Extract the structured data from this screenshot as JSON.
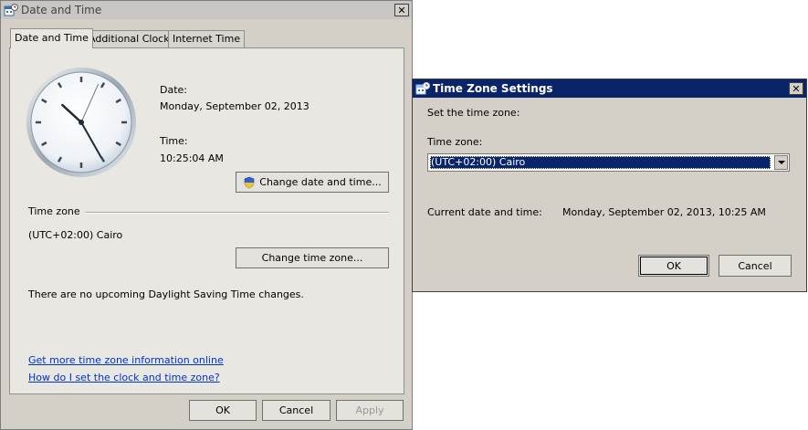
{
  "dt_window": {
    "title": "Date and Time",
    "close_label": "✕",
    "tabs": [
      "Date and Time",
      "Additional Clocks",
      "Internet Time"
    ],
    "date_label": "Date:",
    "date_value": "Monday, September 02, 2013",
    "time_label": "Time:",
    "time_value": "10:25:04 AM",
    "change_datetime_label": "Change date and time...",
    "timezone_heading": "Time zone",
    "timezone_value": "(UTC+02:00) Cairo",
    "change_timezone_label": "Change time zone...",
    "dst_text": "There are no upcoming Daylight Saving Time changes.",
    "link_more_info": "Get more time zone information online",
    "link_how_set": "How do I set the clock and time zone?",
    "ok_label": "OK",
    "cancel_label": "Cancel",
    "apply_label": "Apply"
  },
  "tz_window": {
    "title": "Time Zone Settings",
    "close_label": "✕",
    "instruction": "Set the time zone:",
    "timezone_label": "Time zone:",
    "timezone_selected": "(UTC+02:00) Cairo",
    "current_label": "Current date and time:",
    "current_value": "Monday, September 02, 2013, 10:25 AM",
    "ok_label": "OK",
    "cancel_label": "Cancel"
  },
  "clock": {
    "hour": 10,
    "minute": 25,
    "second": 4
  },
  "colors": {
    "active_title": "#0a246a",
    "dialog_bg": "#d4d0c8",
    "link": "#0033cc"
  }
}
